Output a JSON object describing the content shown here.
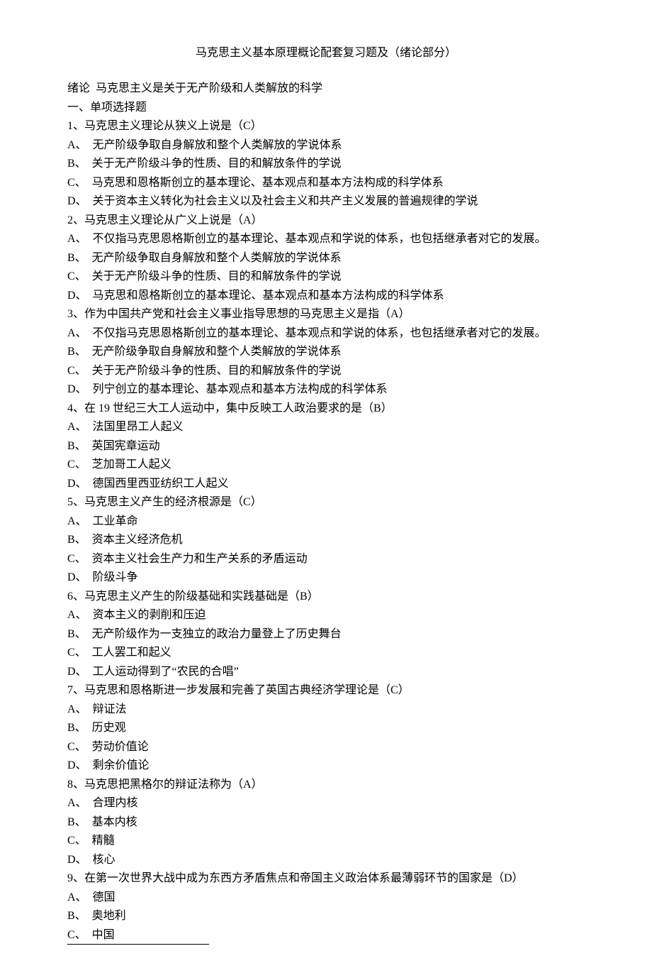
{
  "title": "马克思主义基本原理概论配套复习题及（绪论部分）",
  "lines": [
    "绪论  马克思主义是关于无产阶级和人类解放的科学",
    "一、单项选择题",
    "1、马克思主义理论从狭义上说是（C）",
    "A、  无产阶级争取自身解放和整个人类解放的学说体系",
    "B、  关于无产阶级斗争的性质、目的和解放条件的学说",
    "C、  马克思和恩格斯创立的基本理论、基本观点和基本方法构成的科学体系",
    "D、  关于资本主义转化为社会主义以及社会主义和共产主义发展的普遍规律的学说",
    "2、马克思主义理论从广义上说是（A）",
    "A、  不仅指马克思恩格斯创立的基本理论、基本观点和学说的体系，也包括继承者对它的发展。",
    "B、  无产阶级争取自身解放和整个人类解放的学说体系",
    "C、  关于无产阶级斗争的性质、目的和解放条件的学说",
    "D、  马克思和恩格斯创立的基本理论、基本观点和基本方法构成的科学体系",
    "3、作为中国共产党和社会主义事业指导思想的马克思主义是指（A）",
    "A、  不仅指马克思恩格斯创立的基本理论、基本观点和学说的体系，也包括继承者对它的发展。",
    "B、  无产阶级争取自身解放和整个人类解放的学说体系",
    "C、  关于无产阶级斗争的性质、目的和解放条件的学说",
    "D、  列宁创立的基本理论、基本观点和基本方法构成的科学体系",
    "4、在 19 世纪三大工人运动中，集中反映工人政治要求的是（B）",
    "A、  法国里昂工人起义",
    "B、  英国宪章运动",
    "C、  芝加哥工人起义",
    "D、  德国西里西亚纺织工人起义",
    "5、马克思主义产生的经济根源是（C）",
    "A、  工业革命",
    "B、  资本主义经济危机",
    "C、  资本主义社会生产力和生产关系的矛盾运动",
    "D、  阶级斗争",
    "6、马克思主义产生的阶级基础和实践基础是（B）",
    "A、  资本主义的剥削和压迫",
    "B、  无产阶级作为一支独立的政治力量登上了历史舞台",
    "C、  工人罢工和起义",
    "D、  工人运动得到了“农民的合唱”",
    "7、马克思和恩格斯进一步发展和完善了英国古典经济学理论是（C）",
    "A、  辩证法",
    "B、  历史观",
    "C、  劳动价值论",
    "D、  剩余价值论",
    "8、马克思把黑格尔的辩证法称为（A）",
    "A、  合理内核",
    "B、  基本内核",
    "C、  精髓",
    "D、  核心",
    "9、在第一次世界大战中成为东西方矛盾焦点和帝国主义政治体系最薄弱环节的国家是（D）",
    "A、  德国",
    "B、  奥地利",
    "C、  中国"
  ]
}
